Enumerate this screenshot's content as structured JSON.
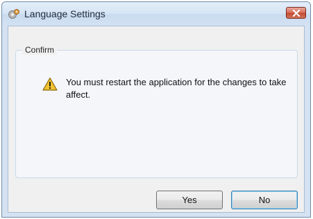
{
  "window": {
    "title": "Language Settings",
    "app_icon": "gear-app-icon",
    "close_icon": "close-icon"
  },
  "group": {
    "legend": "Confirm"
  },
  "message": {
    "icon": "warning-icon",
    "text": "You must restart the application for the changes to take affect."
  },
  "buttons": {
    "yes_label": "Yes",
    "no_label": "No"
  },
  "colors": {
    "close_button": "#c34a31",
    "warning_fill": "#f2c230",
    "default_button_border": "#3c7fb1"
  }
}
